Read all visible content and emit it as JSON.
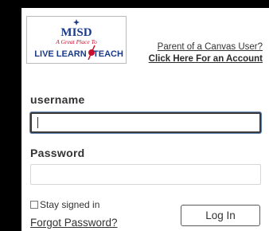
{
  "logo": {
    "top_text": "MISD",
    "tagline": "A Great Place To",
    "bottom_text_left": "LIVE LEARN",
    "bottom_text_right": "TEACH",
    "brand_color": "#1a3a8a",
    "accent_color": "#c8102e"
  },
  "parent_link": {
    "line1": "Parent of a Canvas User?",
    "line2": "Click Here For an Account"
  },
  "username": {
    "label": "username",
    "value": "",
    "placeholder": ""
  },
  "password": {
    "label": "Password",
    "value": "",
    "placeholder": ""
  },
  "remember": {
    "label": "Stay signed in",
    "checked": false
  },
  "forgot_link": "Forgot Password?",
  "login_button": "Log In"
}
